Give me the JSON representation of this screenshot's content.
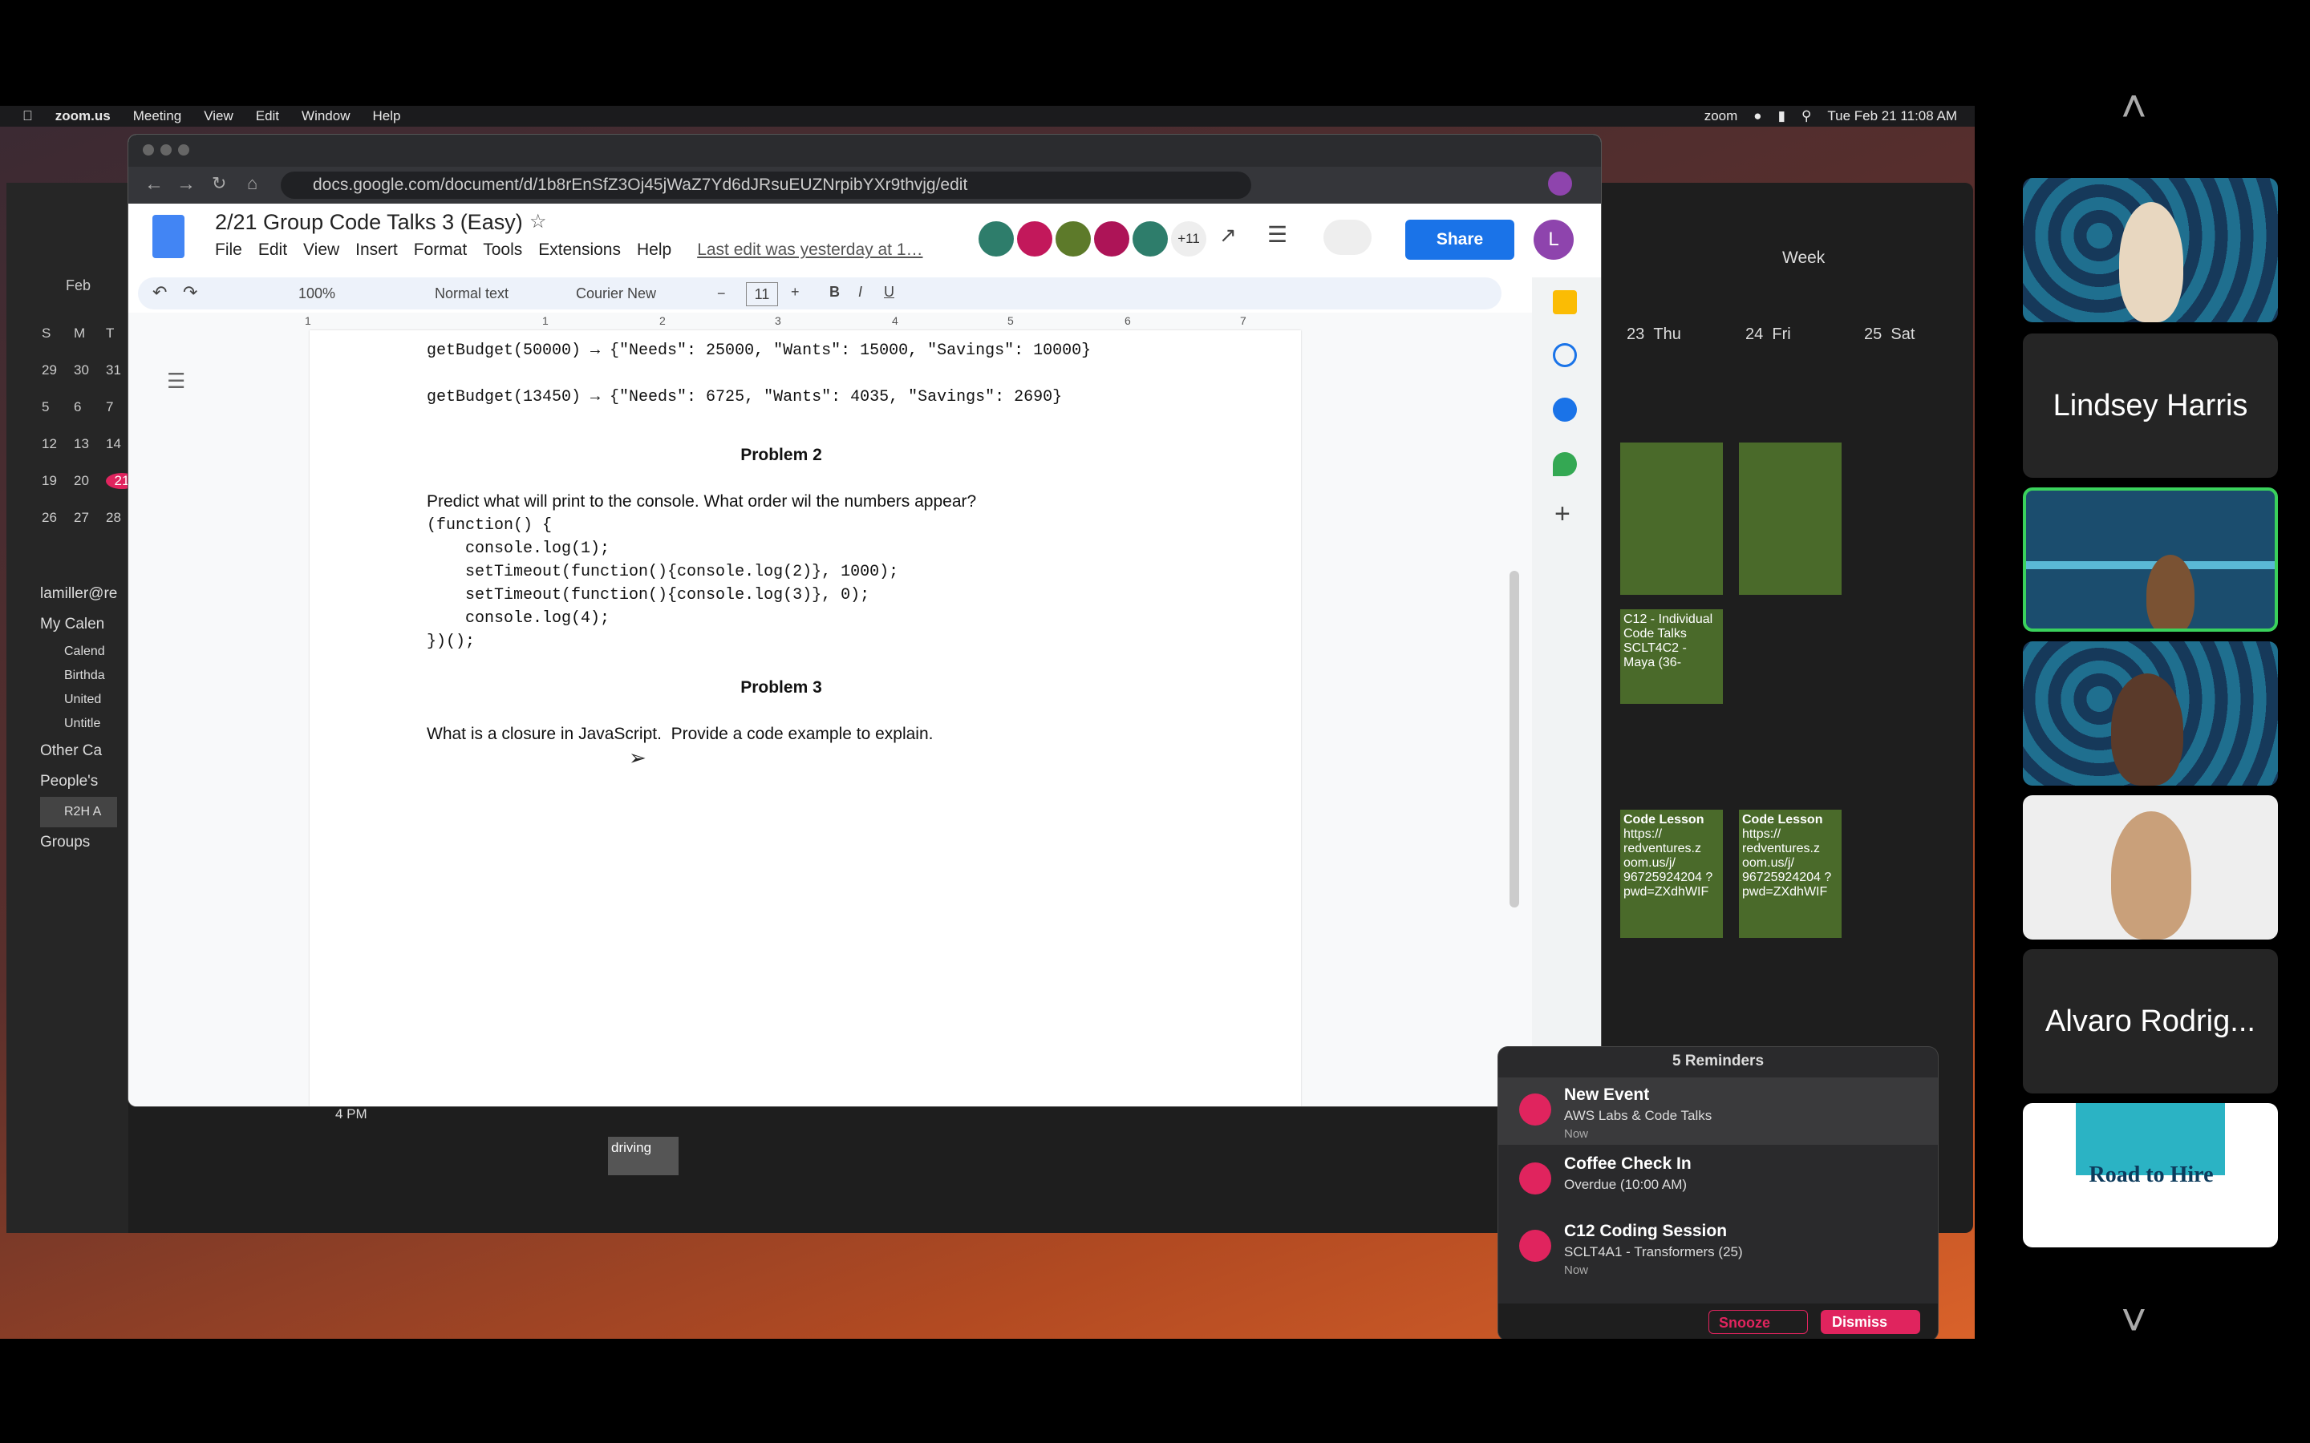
{
  "mac": {
    "app_name": "zoom.us",
    "menu": [
      "Meeting",
      "View",
      "Edit",
      "Window",
      "Help"
    ],
    "status_right": "zoom",
    "datetime": "Tue Feb 21  11:08 AM"
  },
  "chrome": {
    "url": "docs.google.com/document/d/1b8rEnSfZ3Oj45jWaZ7Yd6dJRsuEUZNrpibYXr9thvjg/edit"
  },
  "docs": {
    "title": "2/21 Group Code Talks 3 (Easy)",
    "menu": [
      "File",
      "Edit",
      "View",
      "Insert",
      "Format",
      "Tools",
      "Extensions",
      "Help"
    ],
    "last_edit": "Last edit was yesterday at 1…",
    "collab_count": "+11",
    "share_label": "Share",
    "account_initial": "L",
    "toolbar": {
      "zoom": "100%",
      "style": "Normal text",
      "font": "Courier New",
      "size": "11"
    },
    "ruler_marks": [
      "1",
      "1",
      "2",
      "3",
      "4",
      "5",
      "6",
      "7"
    ],
    "content": {
      "line1": "getBudget(50000) → {\"Needs\": 25000, \"Wants\": 15000, \"Savings\": 10000}",
      "line2": "getBudget(13450) → {\"Needs\": 6725, \"Wants\": 4035, \"Savings\": 2690}",
      "p2_heading": "Problem 2",
      "p2_question": "Predict what will print to the console. What order wil the numbers appear?",
      "p2_code": [
        "(function() {",
        "    console.log(1);",
        "    setTimeout(function(){console.log(2)}, 1000);",
        "    setTimeout(function(){console.log(3)}, 0);",
        "    console.log(4);",
        "})();"
      ],
      "p3_heading": "Problem 3",
      "p3_question": "What is a closure in JavaScript.  Provide a code example to explain."
    }
  },
  "calendar": {
    "month": "Feb",
    "weekday_headers": [
      "S",
      "M",
      "T"
    ],
    "weeks": [
      [
        "29",
        "30",
        "31"
      ],
      [
        "5",
        "6",
        "7"
      ],
      [
        "12",
        "13",
        "14"
      ],
      [
        "19",
        "20",
        "21"
      ],
      [
        "26",
        "27",
        "28"
      ]
    ],
    "account": "lamiller@re",
    "my_calendars_label": "My Calen",
    "calendars": [
      "Calend",
      "Birthda",
      "United",
      "Untitle"
    ],
    "other_label": "Other Ca",
    "peoples_label": "People's",
    "r2h_label": "R2H A",
    "groups_label": "Groups",
    "view_label": "Week",
    "day_headers": [
      {
        "num": "23",
        "day": "Thu"
      },
      {
        "num": "24",
        "day": "Fri"
      },
      {
        "num": "25",
        "day": "Sat"
      }
    ],
    "event_c12": "C12 - Individual Code Talks SCLT4C2 - Maya (36-",
    "event_lesson_title": "Code Lesson",
    "event_lesson_body": "https:// redventures.z oom.us/j/ 96725924204 ? pwd=ZXdhWIF",
    "time_label": "4 PM",
    "event_driving": "driving"
  },
  "reminders": {
    "title": "5 Reminders",
    "items": [
      {
        "title": "New Event",
        "subtitle": "AWS Labs & Code Talks",
        "when": "Now"
      },
      {
        "title": "Coffee Check In",
        "subtitle": "Overdue (10:00 AM)",
        "when": ""
      },
      {
        "title": "C12 Coding Session",
        "subtitle": "SCLT4A1 - Transformers (25)",
        "when": "Now"
      }
    ],
    "snooze_label": "Snooze",
    "dismiss_label": "Dismiss"
  },
  "participants": {
    "names": [
      "Lindsey Harris",
      "Alvaro Rodrig..."
    ],
    "logo_text": "Road to Hire"
  },
  "colors": {
    "accent_blue": "#1a73e8",
    "calendar_green": "#4a6a2a",
    "reminder_pink": "#e0245e",
    "active_border": "#3ad15c"
  }
}
